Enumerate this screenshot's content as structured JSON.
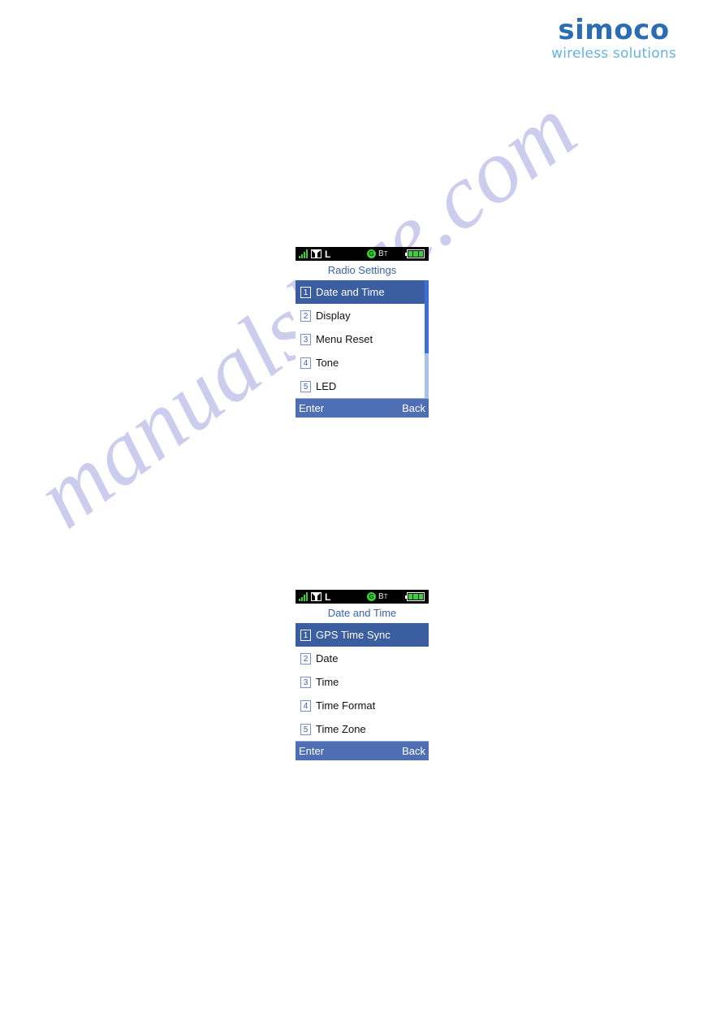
{
  "brand": {
    "name": "simoco",
    "tagline": "wireless solutions",
    "color_main": "#2a6db5",
    "color_sub": "#63b4e4"
  },
  "watermark": {
    "text": "manualshive.com",
    "color": "#ccccee"
  },
  "screens": [
    {
      "id": "radio-settings",
      "status_bar": {
        "signal_icon": "signal-bars-icon",
        "signal_bars": 4,
        "message_icon": "message-envelope-icon",
        "mode_letter": "L",
        "gps_icon": "gps-icon",
        "gps_label": "G",
        "bluetooth_label": "B",
        "bluetooth_sub": "T",
        "battery_icon": "battery-icon",
        "battery_segments": 3
      },
      "title": "Radio Settings",
      "items": [
        {
          "num": "1",
          "label": "Date and Time",
          "selected": true
        },
        {
          "num": "2",
          "label": "Display",
          "selected": false
        },
        {
          "num": "3",
          "label": "Menu Reset",
          "selected": false
        },
        {
          "num": "4",
          "label": "Tone",
          "selected": false
        },
        {
          "num": "5",
          "label": "LED",
          "selected": false
        }
      ],
      "scrollbar": {
        "visible": true,
        "thumb_top_pct": 0,
        "thumb_height_pct": 62
      },
      "footer": {
        "left": "Enter",
        "right": "Back"
      }
    },
    {
      "id": "date-and-time",
      "status_bar": {
        "signal_icon": "signal-bars-icon",
        "signal_bars": 4,
        "message_icon": "message-envelope-icon",
        "mode_letter": "L",
        "gps_icon": "gps-icon",
        "gps_label": "G",
        "bluetooth_label": "B",
        "bluetooth_sub": "T",
        "battery_icon": "battery-icon",
        "battery_segments": 3
      },
      "title": "Date and Time",
      "items": [
        {
          "num": "1",
          "label": "GPS Time Sync",
          "selected": true
        },
        {
          "num": "2",
          "label": "Date",
          "selected": false
        },
        {
          "num": "3",
          "label": "Time",
          "selected": false
        },
        {
          "num": "4",
          "label": "Time Format",
          "selected": false
        },
        {
          "num": "5",
          "label": "Time Zone",
          "selected": false
        }
      ],
      "scrollbar": {
        "visible": false,
        "thumb_top_pct": 0,
        "thumb_height_pct": 0
      },
      "footer": {
        "left": "Enter",
        "right": "Back"
      }
    }
  ]
}
